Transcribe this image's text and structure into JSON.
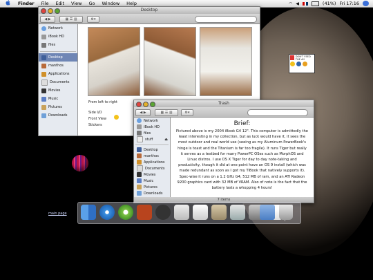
{
  "menubar": {
    "apple_icon": "apple-icon",
    "app": "Finder",
    "menus": [
      "File",
      "Edit",
      "View",
      "Go",
      "Window",
      "Help"
    ],
    "battery": "(41%)",
    "time": "Fri 17:16"
  },
  "desktop": {
    "shortcut_label": "main page",
    "widget_text": "DON'T FEED THE AI!"
  },
  "finder": {
    "title": "Desktop",
    "sidebar_devices": [
      "Network",
      "iBook HD",
      "files"
    ],
    "sidebar_places": [
      "Desktop",
      "manthos",
      "Applications",
      "Documents",
      "Movies",
      "Music",
      "Pictures",
      "Downloads"
    ],
    "selected": "Desktop",
    "captions": [
      "From left to right",
      "Side I/O",
      "Front View",
      "Stickers"
    ]
  },
  "trash": {
    "title": "Trash",
    "sidebar_devices": [
      "Network",
      "iBook HD",
      "files",
      "stuff"
    ],
    "sidebar_places": [
      "Desktop",
      "manthos",
      "Applications",
      "Documents",
      "Movies",
      "Music",
      "Pictures",
      "Downloads"
    ],
    "status": "7 items",
    "heading": "Brief:",
    "body": "Pictured above is my 2004 iBook G4 12\". This computer is admittedly the least interesting in my collection, but as luck would have it, it sees the most outdoor and real world use (seeing as my Aluminum PowerBook's hinge is toast and the Titanium is far too fragile). It runs Tiger but really it serves as a testbed for many PowerPC OSes such as MorphOS and Linux distros. I use OS X Tiger for day to day note-taking and productivity, though it did at one point have an OS 9 install (which was made redundant as soon as I got my TiBook that natively supports it). Spec-wise it runs on a 1.2 GHz G4, 512 MB of ram, and an ATI Radeon 9200 graphics card with 32 MB of VRAM. Also of note is the fact that the battery lasts a whopping 4 hours!"
  },
  "dock": {
    "items": [
      "Finder",
      "Safari",
      "iTunes",
      "Photo Booth",
      "Cloud",
      "Preview",
      "TextEdit",
      "Contacts",
      "iPhoto",
      "System Preferences",
      "Calendar",
      "Applications",
      "Trash"
    ]
  },
  "colors": {
    "selection": "#6f86b5",
    "desktop_bg": "#000000"
  }
}
